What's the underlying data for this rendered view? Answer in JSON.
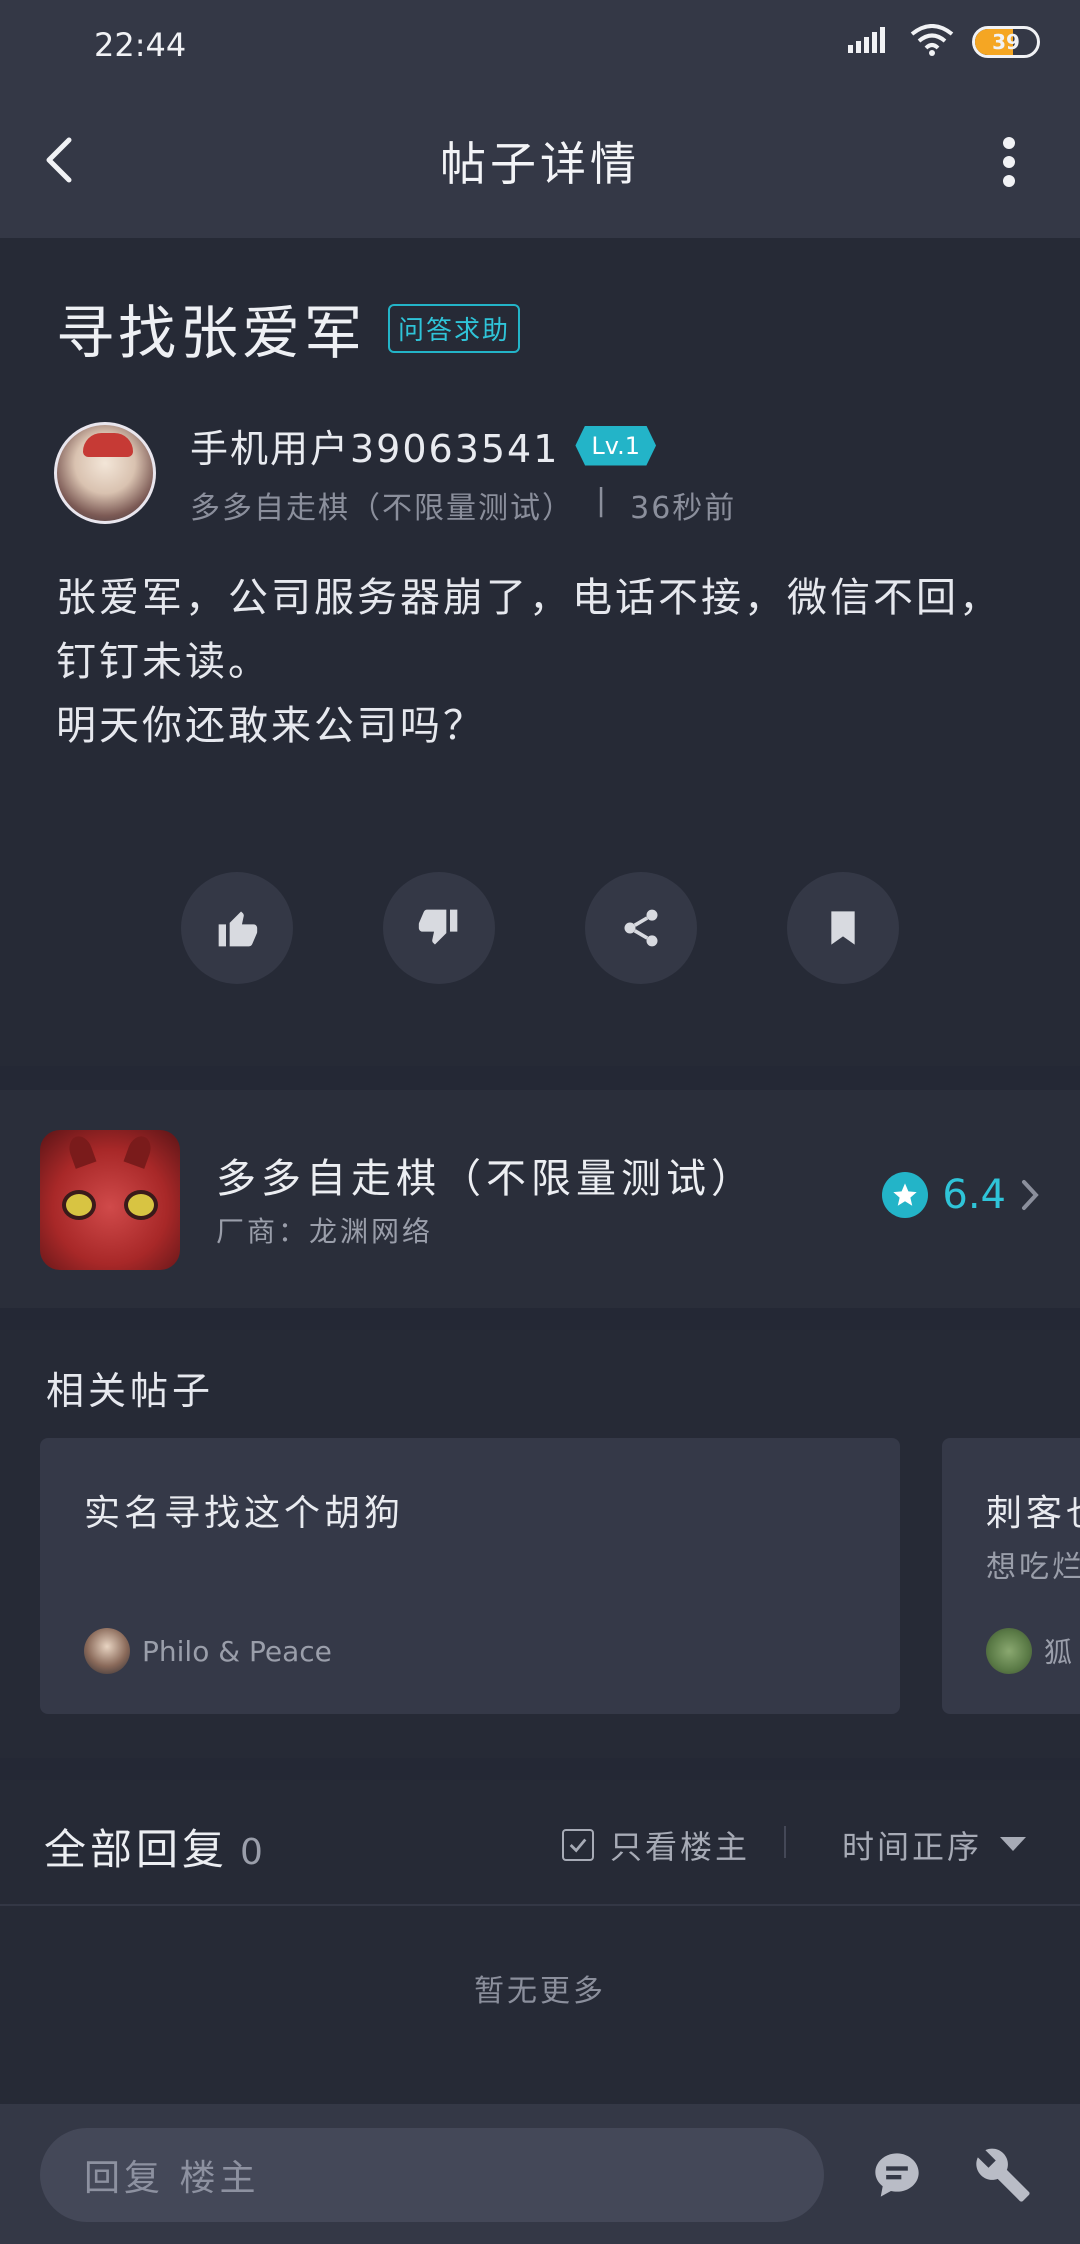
{
  "status": {
    "time": "22:44",
    "battery": "39"
  },
  "header": {
    "title": "帖子详情"
  },
  "post": {
    "title": "寻找张爱军",
    "tag": "问答求助",
    "author": {
      "name": "手机用户39063541",
      "level": "Lv.1",
      "game": "多多自走棋（不限量测试）",
      "time_sep": "|",
      "time": "36秒前"
    },
    "body": [
      "张爱军，公司服务器崩了，电话不接，微信不回，",
      "钉钉未读。",
      "明天你还敢来公司吗？"
    ],
    "actions": {
      "like": "thumbs-up-icon",
      "dislike": "thumbs-down-icon",
      "share": "share-icon",
      "bookmark": "bookmark-icon"
    }
  },
  "game": {
    "name": "多多自走棋（不限量测试）",
    "vendor": "厂商：龙渊网络",
    "rating": "6.4",
    "accent": "#23b4c8"
  },
  "related": {
    "title": "相关帖子",
    "cards": [
      {
        "title": "实名寻找这个胡狗",
        "subtitle": "",
        "user": "Philo & Peace"
      },
      {
        "title": "刺客也",
        "subtitle": "想吃烂",
        "user": "狐"
      }
    ]
  },
  "replies": {
    "title": "全部回复",
    "count": "0",
    "only_op": "只看楼主",
    "sort": "时间正序",
    "empty": "暂无更多"
  },
  "bottom": {
    "placeholder": "回复 楼主"
  }
}
